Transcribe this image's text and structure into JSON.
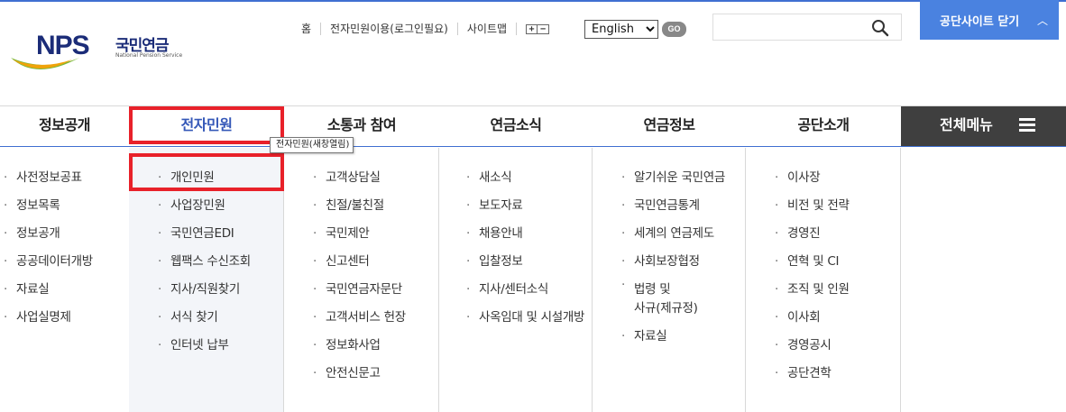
{
  "logo": {
    "mark": "NPS",
    "name_kr": "국민연금",
    "name_en": "National Pension Service"
  },
  "utility": {
    "home": "홈",
    "e_civil": "전자민원이용(로그인필요)",
    "sitemap": "사이트맵",
    "zoom_in": "+",
    "zoom_out": "−",
    "language": "English",
    "go": "GO",
    "search_value": "",
    "close_site": "공단사이트 닫기",
    "close_icon": "chevron-up-icon"
  },
  "gnb": {
    "items": [
      "정보공개",
      "전자민원",
      "소통과 참여",
      "연금소식",
      "연금정보",
      "공단소개"
    ],
    "all_menu": "전체메뉴",
    "tooltip": "전자민원(새창열림)"
  },
  "submenus": [
    [
      "사전정보공표",
      "정보목록",
      "정보공개",
      "공공데이터개방",
      "자료실",
      "사업실명제"
    ],
    [
      "개인민원",
      "사업장민원",
      "국민연금EDI",
      "웹팩스 수신조회",
      "지사/직원찾기",
      "서식 찾기",
      "인터넷 납부"
    ],
    [
      "고객상담실",
      "친절/불친절",
      "국민제안",
      "신고센터",
      "국민연금자문단",
      "고객서비스 헌장",
      "정보화사업",
      "안전신문고"
    ],
    [
      "새소식",
      "보도자료",
      "채용안내",
      "입찰정보",
      "지사/센터소식",
      "사옥임대 및 시설개방"
    ],
    [
      "알기쉬운 국민연금",
      "국민연금통계",
      "세계의 연금제도",
      "사회보장협정",
      "법령 및",
      "사규(제규정)",
      "자료실"
    ],
    [
      "이사장",
      "비전 및 전략",
      "경영진",
      "연혁 및 CI",
      "조직 및 인원",
      "이사회",
      "경영공시",
      "공단견학"
    ]
  ],
  "colors": {
    "accent": "#3f6fd1",
    "button_blue": "#4a82e0",
    "highlight_red": "#e8212a",
    "dark": "#3f3f3f"
  }
}
